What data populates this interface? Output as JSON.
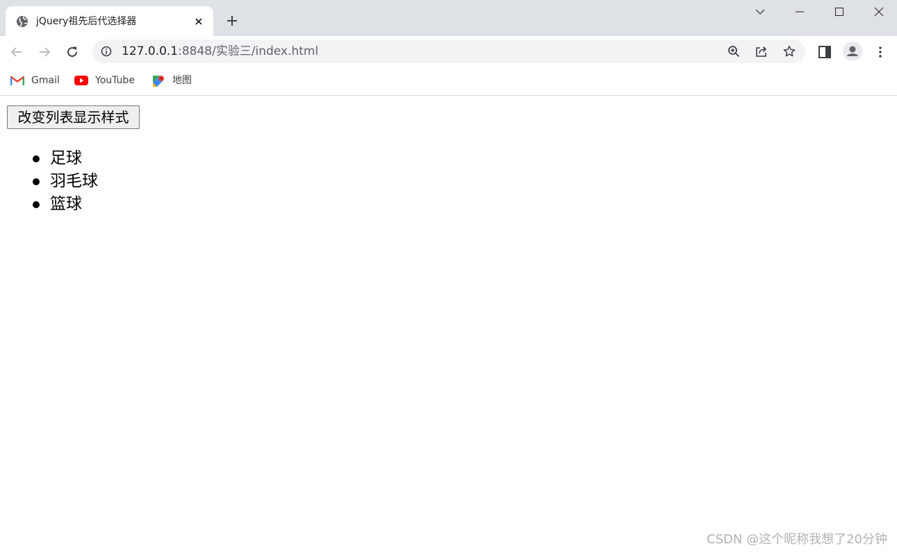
{
  "browser": {
    "tab_title": "jQuery祖先后代选择器",
    "url_host": "127.0.0.1",
    "url_rest": ":8848/实验三/index.html",
    "bookmarks": [
      {
        "label": "Gmail",
        "icon": "gmail-icon"
      },
      {
        "label": "YouTube",
        "icon": "youtube-icon"
      },
      {
        "label": "地图",
        "icon": "maps-icon"
      }
    ]
  },
  "page": {
    "button_label": "改变列表显示样式",
    "list_items": [
      "足球",
      "羽毛球",
      "篮球"
    ]
  },
  "watermark": "CSDN @这个昵称我想了20分钟",
  "colors": {
    "tabstrip_bg": "#dee1e6",
    "omnibox_bg": "#f1f3f4",
    "youtube_red": "#ff0000",
    "gmail_red": "#ea4335"
  }
}
